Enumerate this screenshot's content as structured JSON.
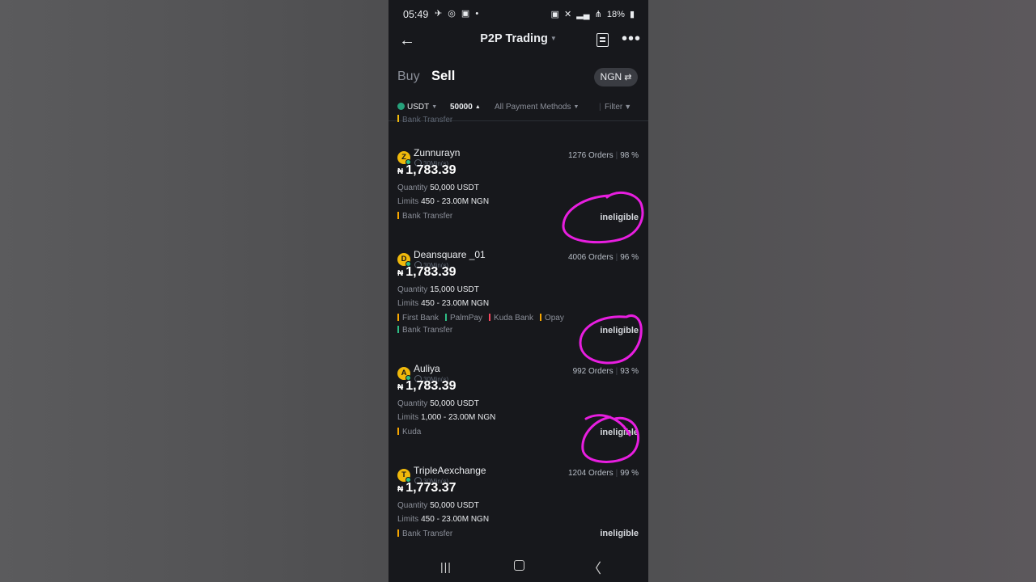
{
  "status_bar": {
    "time": "05:49",
    "left_icons": "✈ ◎ ▣ •",
    "battery": "18%"
  },
  "header": {
    "title": "P2P Trading"
  },
  "tabs": {
    "buy": "Buy",
    "sell": "Sell",
    "currency": "NGN"
  },
  "filters": {
    "coin": "USDT",
    "amount": "50000",
    "payment": "All Payment Methods",
    "filter": "Filter"
  },
  "partial_method": "Bank Transfer",
  "ads": [
    {
      "initial": "Z",
      "name": "Zunnurayn",
      "time_limit": "30Min(s)",
      "orders": "1276 Orders",
      "completion": "98 %",
      "currency_symbol": "₦",
      "price": "1,783.39",
      "quantity_label": "Quantity",
      "quantity": "50,000 USDT",
      "limits_label": "Limits",
      "limits": "450 - 23.00M NGN",
      "methods": [
        {
          "name": "Bank Transfer",
          "color": "#f7a600"
        }
      ],
      "action": "ineligible"
    },
    {
      "initial": "D",
      "name": "Deansquare _01",
      "time_limit": "30Min(s)",
      "orders": "4006 Orders",
      "completion": "96 %",
      "currency_symbol": "₦",
      "price": "1,783.39",
      "quantity_label": "Quantity",
      "quantity": "15,000 USDT",
      "limits_label": "Limits",
      "limits": "450 - 23.00M NGN",
      "methods": [
        {
          "name": "First Bank",
          "color": "#f7a600"
        },
        {
          "name": "PalmPay",
          "color": "#2ebd85"
        },
        {
          "name": "Kuda Bank",
          "color": "#f6465d"
        },
        {
          "name": "Opay",
          "color": "#f7a600"
        },
        {
          "name": "Bank Transfer",
          "color": "#2ebd85"
        }
      ],
      "action": "ineligible"
    },
    {
      "initial": "A",
      "name": "Auliya",
      "time_limit": "30Min(s)",
      "orders": "992 Orders",
      "completion": "93 %",
      "currency_symbol": "₦",
      "price": "1,783.39",
      "quantity_label": "Quantity",
      "quantity": "50,000 USDT",
      "limits_label": "Limits",
      "limits": "1,000 - 23.00M NGN",
      "methods": [
        {
          "name": "Kuda",
          "color": "#f7a600"
        }
      ],
      "action": "ineligible"
    },
    {
      "initial": "T",
      "name": "TripleAexchange",
      "time_limit": "30Min(s)",
      "orders": "1204 Orders",
      "completion": "99 %",
      "currency_symbol": "₦",
      "price": "1,773.37",
      "quantity_label": "Quantity",
      "quantity": "50,000 USDT",
      "limits_label": "Limits",
      "limits": "450 - 23.00M NGN",
      "methods": [
        {
          "name": "Bank Transfer",
          "color": "#f7a600"
        }
      ],
      "action": "ineligible"
    }
  ],
  "colors": {
    "annotation": "#e81ee0",
    "background": "#17181c",
    "accent": "#f0b90b"
  }
}
